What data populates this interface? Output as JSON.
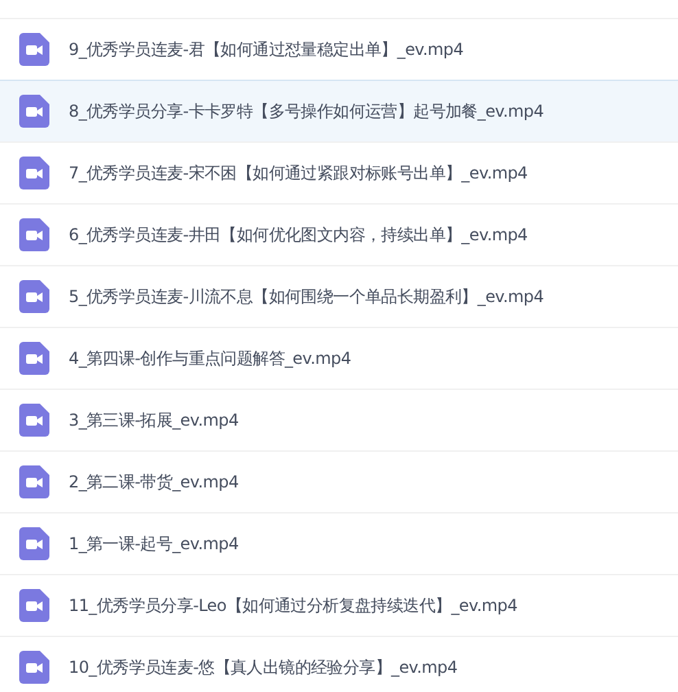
{
  "files": [
    {
      "name": "9_优秀学员连麦-君【如何通过怼量稳定出单】_ev.mp4",
      "selected": false
    },
    {
      "name": "8_优秀学员分享-卡卡罗特【多号操作如何运营】起号加餐_ev.mp4",
      "selected": true
    },
    {
      "name": "7_优秀学员连麦-宋不困【如何通过紧跟对标账号出单】_ev.mp4",
      "selected": false
    },
    {
      "name": "6_优秀学员连麦-井田【如何优化图文内容，持续出单】_ev.mp4",
      "selected": false
    },
    {
      "name": "5_优秀学员连麦-川流不息【如何围绕一个单品长期盈利】_ev.mp4",
      "selected": false
    },
    {
      "name": "4_第四课-创作与重点问题解答_ev.mp4",
      "selected": false
    },
    {
      "name": "3_第三课-拓展_ev.mp4",
      "selected": false
    },
    {
      "name": "2_第二课-带货_ev.mp4",
      "selected": false
    },
    {
      "name": "1_第一课-起号_ev.mp4",
      "selected": false
    },
    {
      "name": "11_优秀学员分享-Leo【如何通过分析复盘持续迭代】_ev.mp4",
      "selected": false
    },
    {
      "name": "10_优秀学员连麦-悠【真人出镜的经验分享】_ev.mp4",
      "selected": false
    }
  ]
}
